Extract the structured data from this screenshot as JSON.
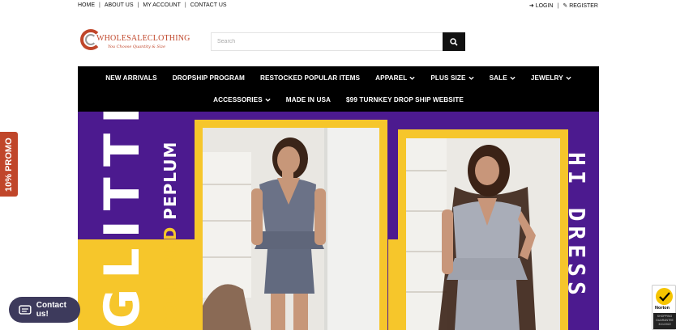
{
  "topbar": {
    "left_links": [
      "HOME",
      "ABOUT US",
      "MY ACCOUNT",
      "CONTACT US"
    ],
    "separator": "|",
    "login": "LOGIN",
    "register": "REGISTER"
  },
  "logo": {
    "name": "WHOLESALECLOTHING",
    "tagline": "You Choose Quantity & Size"
  },
  "search": {
    "placeholder": "Search"
  },
  "nav": {
    "row1": [
      {
        "label": "NEW ARRIVALS",
        "has_caret": false
      },
      {
        "label": "DROPSHIP PROGRAM",
        "has_caret": false
      },
      {
        "label": "RESTOCKED POPULAR ITEMS",
        "has_caret": false
      },
      {
        "label": "APPAREL",
        "has_caret": true
      },
      {
        "label": "PLUS SIZE",
        "has_caret": true
      },
      {
        "label": "SALE",
        "has_caret": true
      },
      {
        "label": "JEWELRY",
        "has_caret": true
      }
    ],
    "row2": [
      {
        "label": "ACCESSORIES",
        "has_caret": true
      },
      {
        "label": "MADE IN USA",
        "has_caret": false
      },
      {
        "label": "$99 TURNKEY DROP SHIP WEBSITE",
        "has_caret": false
      }
    ]
  },
  "banner": {
    "glitter": "GLITTER",
    "collared": "COLLARED",
    "peplum": "PEPLUM",
    "hidress": "HI DRESS",
    "colors": {
      "purple": "#4c1a8f",
      "yellow": "#f6c62b"
    }
  },
  "promo": {
    "label": "10% PROMO"
  },
  "contact": {
    "label": "Contact us!"
  },
  "norton": {
    "brand": "Norton",
    "line1": "SHOPPING",
    "line2": "GUARANTEE",
    "date": "3/11/2022"
  },
  "colors": {
    "brand": "#c0462a",
    "nav_bg": "#000000",
    "contact_bg": "#3d3a5c"
  }
}
